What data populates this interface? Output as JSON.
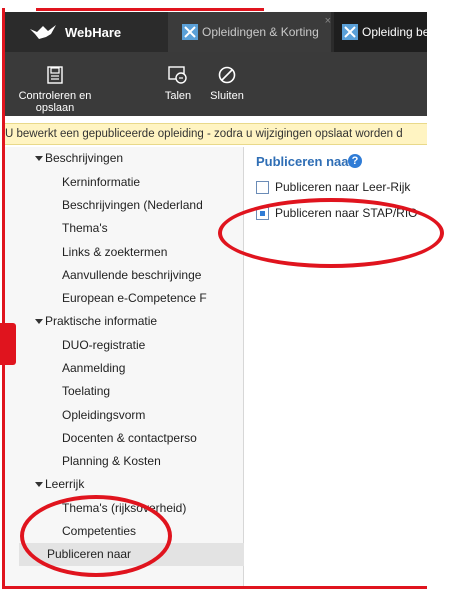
{
  "tabs": {
    "home": "WebHare",
    "tab1": "Opleidingen & Korting",
    "tab1_close": "×",
    "tab2": "Opleiding be"
  },
  "toolbar": {
    "save": "Controleren en opslaan",
    "languages": "Talen",
    "close": "Sluiten"
  },
  "banner": "U bewerkt een gepubliceerde opleiding - zodra u wijzigingen opslaat worden d",
  "sidebar": {
    "groups": [
      {
        "label": "Beschrijvingen",
        "items": [
          "Kerninformatie",
          "Beschrijvingen (Nederland",
          "Thema's",
          "Links & zoektermen",
          "Aanvullende beschrijvinge",
          "European e-Competence F"
        ]
      },
      {
        "label": "Praktische informatie",
        "items": [
          "DUO-registratie",
          "Aanmelding",
          "Toelating",
          "Opleidingsvorm",
          "Docenten & contactperso",
          "Planning & Kosten"
        ]
      },
      {
        "label": "Leerrijk",
        "items": [
          "Thema's (rijksoverheid)",
          "Competenties"
        ]
      }
    ],
    "selected": "Publiceren naar"
  },
  "main": {
    "title": "Publiceren naar",
    "help": "?",
    "options": [
      {
        "label": "Publiceren naar Leer-Rijk",
        "checked": false
      },
      {
        "label": "Publiceren naar STAP/RIO",
        "checked": true
      }
    ]
  },
  "colors": {
    "accent": "#2f6eb5",
    "annotation": "#e0141e",
    "banner": "#fff4c2"
  }
}
